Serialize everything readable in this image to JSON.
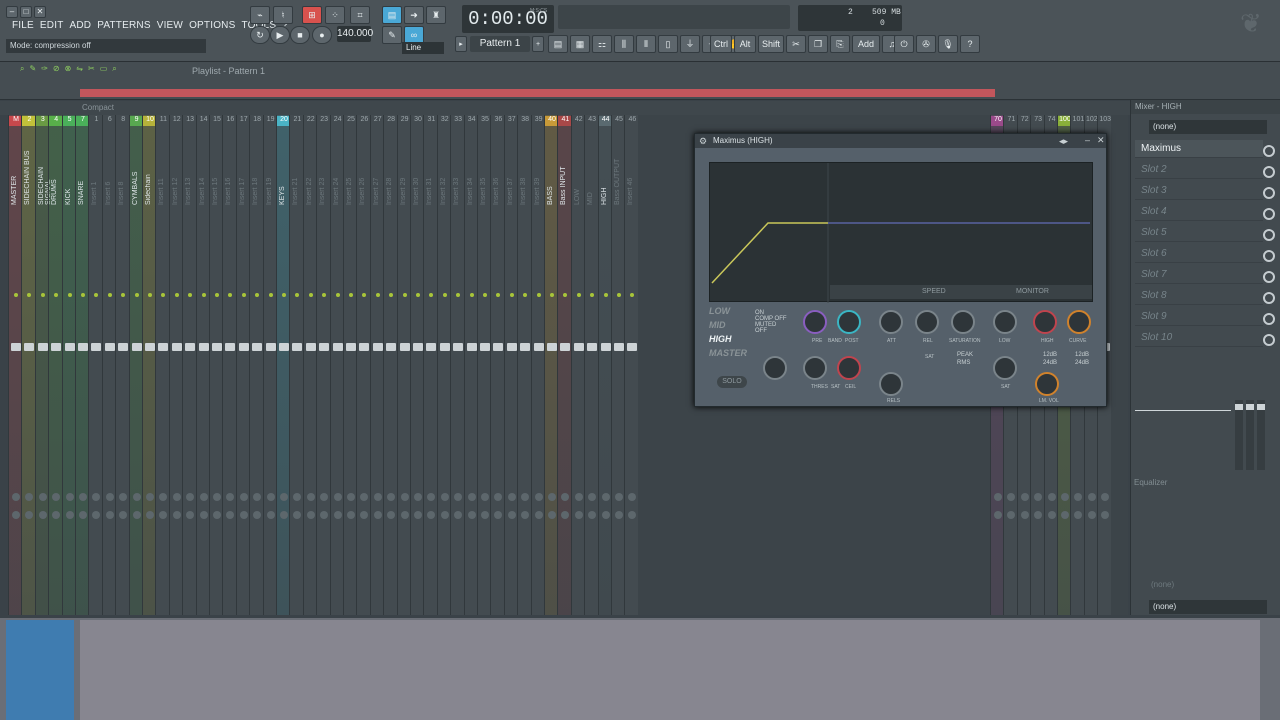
{
  "menu": [
    "FILE",
    "EDIT",
    "ADD",
    "PATTERNS",
    "VIEW",
    "OPTIONS",
    "TOOLS",
    "?"
  ],
  "hint": "Mode: compression off",
  "time": "0:00:00",
  "time_unit": "M:S:CS",
  "tempo": "140.000",
  "line_mode": "Line",
  "pattern": "Pattern 1",
  "cpu": {
    "voices": "2",
    "ram": "509 MB",
    "poly": "0"
  },
  "toolbar_labels": [
    "Ctrl",
    "Alt",
    "Shift",
    "Add"
  ],
  "playlist_title": "Playlist - Pattern 1",
  "mixer_view": "Compact",
  "mixer_window": "Mixer - HIGH",
  "plugin": {
    "title": "Maximus (HIGH)",
    "bands": [
      "LOW",
      "MID",
      "HIGH",
      "MASTER"
    ],
    "mode_options": [
      "ON",
      "COMP OFF",
      "MUTED",
      "OFF"
    ],
    "solo": "SOLO",
    "speed": "SPEED",
    "monitor": "MONITOR",
    "knob_labels": [
      "PRE",
      "BAND",
      "POST",
      "ATT",
      "REL",
      "SATURATION",
      "THRES",
      "SAT",
      "CEIL",
      "LOW",
      "HIGH",
      "CURVE",
      "SAT",
      "SAT",
      "RELS"
    ],
    "peak": "PEAK",
    "rms": "RMS",
    "db_labels": [
      "12dB",
      "24dB",
      "12dB",
      "24dB"
    ],
    "lm_vol": "LM. VOL"
  },
  "slots": {
    "selector": "(none)",
    "items": [
      "Maximus",
      "Slot 2",
      "Slot 3",
      "Slot 4",
      "Slot 5",
      "Slot 6",
      "Slot 7",
      "Slot 8",
      "Slot 9",
      "Slot 10"
    ],
    "eq": "Equalizer",
    "bottom_sel_a": "(none)",
    "bottom_sel_b": "(none)"
  },
  "tracks": [
    {
      "n": "M",
      "name": "MASTER",
      "color": "#c8484c"
    },
    {
      "n": "2",
      "name": "SIDECHAIN BUS",
      "color": "#c2c13a"
    },
    {
      "n": "3",
      "name": "SIDECHAIN SIGNAL",
      "color": "#6a9a44"
    },
    {
      "n": "4",
      "name": "DRUMS",
      "color": "#58b04a"
    },
    {
      "n": "5",
      "name": "KICK",
      "color": "#4ab05a"
    },
    {
      "n": "7",
      "name": "SNARE",
      "color": "#4ab05a"
    },
    {
      "n": "1",
      "name": "Insert 1",
      "color": ""
    },
    {
      "n": "6",
      "name": "Insert 6",
      "color": ""
    },
    {
      "n": "8",
      "name": "Insert 8",
      "color": ""
    },
    {
      "n": "9",
      "name": "CYMBALS",
      "color": "#58a850"
    },
    {
      "n": "10",
      "name": "Sidechain",
      "color": "#b6b23a"
    },
    {
      "n": "11",
      "name": "Insert 11",
      "color": ""
    },
    {
      "n": "12",
      "name": "Insert 12",
      "color": ""
    },
    {
      "n": "13",
      "name": "Insert 13",
      "color": ""
    },
    {
      "n": "14",
      "name": "Insert 14",
      "color": ""
    },
    {
      "n": "15",
      "name": "Insert 15",
      "color": ""
    },
    {
      "n": "16",
      "name": "Insert 16",
      "color": ""
    },
    {
      "n": "17",
      "name": "Insert 17",
      "color": ""
    },
    {
      "n": "18",
      "name": "Insert 18",
      "color": ""
    },
    {
      "n": "19",
      "name": "Insert 19",
      "color": ""
    },
    {
      "n": "20",
      "name": "KEYS",
      "color": "#4ab4c6"
    },
    {
      "n": "21",
      "name": "Insert 21",
      "color": ""
    },
    {
      "n": "22",
      "name": "Insert 22",
      "color": ""
    },
    {
      "n": "23",
      "name": "Insert 23",
      "color": ""
    },
    {
      "n": "24",
      "name": "Insert 24",
      "color": ""
    },
    {
      "n": "25",
      "name": "Insert 25",
      "color": ""
    },
    {
      "n": "26",
      "name": "Insert 26",
      "color": ""
    },
    {
      "n": "27",
      "name": "Insert 27",
      "color": ""
    },
    {
      "n": "28",
      "name": "Insert 28",
      "color": ""
    },
    {
      "n": "29",
      "name": "Insert 29",
      "color": ""
    },
    {
      "n": "30",
      "name": "Insert 30",
      "color": ""
    },
    {
      "n": "31",
      "name": "Insert 31",
      "color": ""
    },
    {
      "n": "32",
      "name": "Insert 32",
      "color": ""
    },
    {
      "n": "33",
      "name": "Insert 33",
      "color": ""
    },
    {
      "n": "34",
      "name": "Insert 34",
      "color": ""
    },
    {
      "n": "35",
      "name": "Insert 35",
      "color": ""
    },
    {
      "n": "36",
      "name": "Insert 36",
      "color": ""
    },
    {
      "n": "37",
      "name": "Insert 37",
      "color": ""
    },
    {
      "n": "38",
      "name": "Insert 38",
      "color": ""
    },
    {
      "n": "39",
      "name": "Insert 39",
      "color": ""
    },
    {
      "n": "40",
      "name": "BASS",
      "color": "#c89a38"
    },
    {
      "n": "41",
      "name": "Bass INPUT",
      "color": "#a84848"
    },
    {
      "n": "42",
      "name": "LOW",
      "color": ""
    },
    {
      "n": "43",
      "name": "MID",
      "color": ""
    },
    {
      "n": "44",
      "name": "HIGH",
      "color": "#5a6a70"
    },
    {
      "n": "45",
      "name": "Bass OUTPUT",
      "color": ""
    },
    {
      "n": "46",
      "name": "Insert 46",
      "color": ""
    }
  ],
  "right_tracks": [
    {
      "n": "70",
      "name": "",
      "color": "#9a4a8a"
    },
    {
      "n": "71",
      "name": "",
      "color": ""
    },
    {
      "n": "72",
      "name": "",
      "color": ""
    },
    {
      "n": "73",
      "name": "",
      "color": ""
    },
    {
      "n": "74",
      "name": "",
      "color": ""
    },
    {
      "n": "100",
      "name": "",
      "color": "#8ab03a"
    },
    {
      "n": "101",
      "name": "",
      "color": ""
    },
    {
      "n": "102",
      "name": "",
      "color": ""
    },
    {
      "n": "103",
      "name": "",
      "color": ""
    }
  ]
}
